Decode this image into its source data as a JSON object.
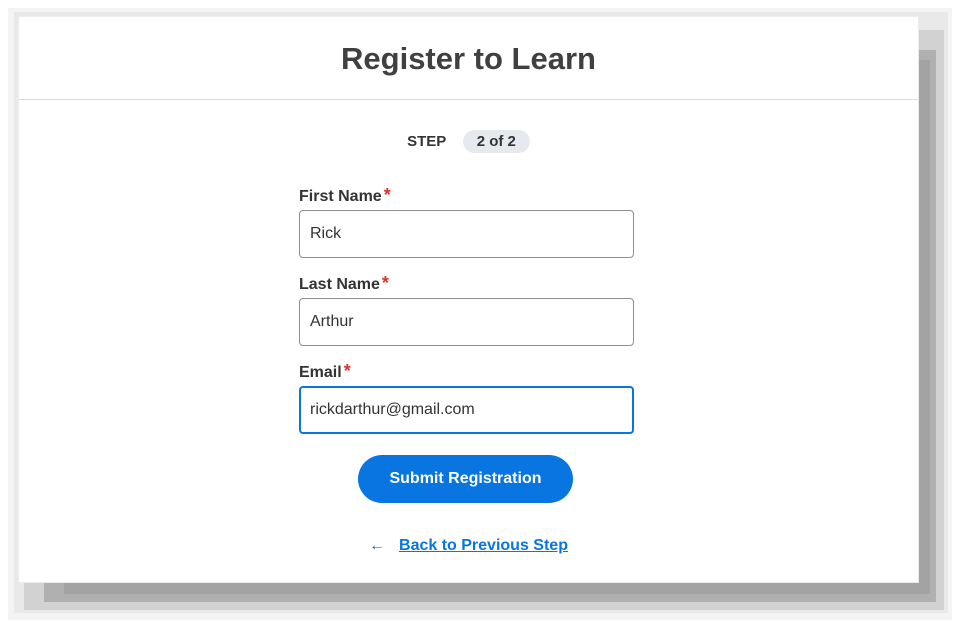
{
  "header": {
    "title": "Register to Learn"
  },
  "step": {
    "label": "STEP",
    "value": "2 of 2"
  },
  "form": {
    "first_name": {
      "label": "First Name",
      "required_mark": "*",
      "value": "Rick"
    },
    "last_name": {
      "label": "Last Name",
      "required_mark": "*",
      "value": "Arthur"
    },
    "email": {
      "label": "Email",
      "required_mark": "*",
      "value": "rickdarthur@gmail.com"
    },
    "submit_label": "Submit Registration"
  },
  "back": {
    "arrow_icon": "left-arrow-icon",
    "arrow_glyph": "←",
    "label": "Back to Previous Step"
  },
  "colors": {
    "accent": "#0875e1",
    "required": "#d9342b",
    "title": "#404040",
    "pill_bg": "#e6e9ed"
  }
}
